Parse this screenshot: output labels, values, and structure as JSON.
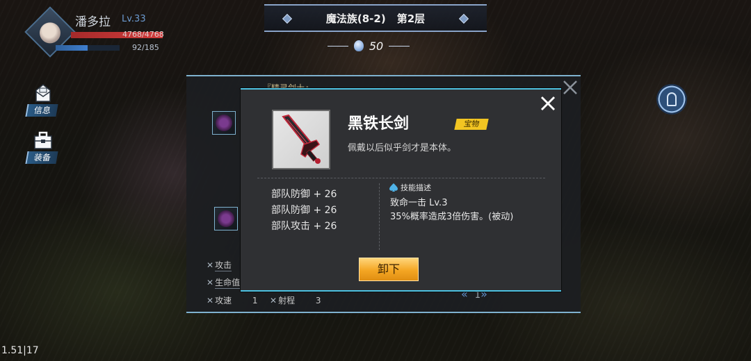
{
  "player": {
    "name": "潘多拉",
    "level": "Lv.33",
    "hp_text": "4768/4768",
    "hp_fraction": 1.0,
    "mp_text": "92/185",
    "mp_fraction": 0.5
  },
  "stage": {
    "title": "魔法族(8-2)",
    "floor": "第2层"
  },
  "currency": {
    "value": "50",
    "icon": "gem-icon"
  },
  "side_menu": {
    "info_label": "信息",
    "equip_label": "装备"
  },
  "back_panel": {
    "header": "『精灵剑士』",
    "stats": [
      {
        "label": "攻击",
        "value": ""
      },
      {
        "label": "生命值",
        "value": ""
      },
      {
        "label": "攻速",
        "value": "1"
      },
      {
        "label": "射程",
        "value": "3"
      }
    ],
    "page": "1"
  },
  "item": {
    "name": "黑铁长剑",
    "badge": "宝物",
    "description": "佩戴以后似乎剑才是本体。",
    "bonuses": [
      "部队防御 + 26",
      "部队防御 + 26",
      "部队攻击 + 26"
    ],
    "skill_header": "技能描述",
    "skill_name": "致命一击 Lv.3",
    "skill_desc": "35%概率造成3倍伤害。(被动)"
  },
  "buttons": {
    "unequip": "卸下"
  },
  "fps": "1.51|17",
  "colors": {
    "accent": "#4fc3e3",
    "badge": "#f2c522",
    "button": "#f4a623"
  }
}
